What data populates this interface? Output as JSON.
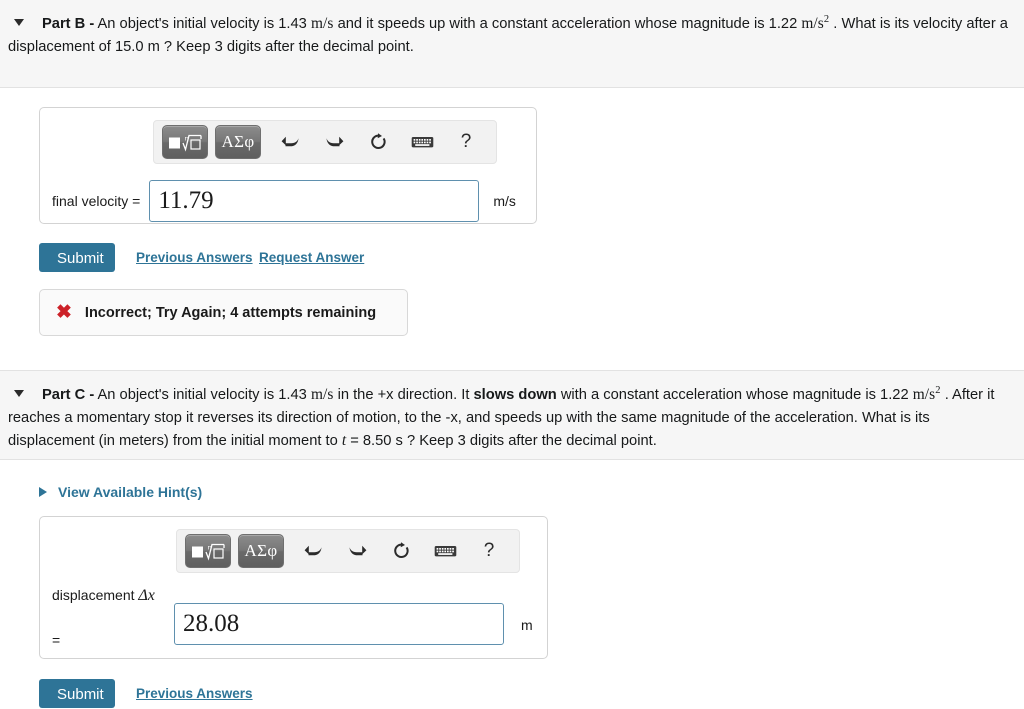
{
  "part_b": {
    "caret_icon": "caret-down-icon",
    "label": "Part B -",
    "text_1": " An object's initial velocity is 1.43 ",
    "math_1": "m/s",
    "text_2": " and it speeds up with a constant acceleration whose magnitude is 1.22 ",
    "math_2": "m/s",
    "math_2_sup": "2",
    "text_3": " . What is its velocity after a displacement of 15.0 m ? Keep 3 digits after the decimal point.",
    "toolbar": {
      "template_button": "template-icon",
      "greek_button": "ΑΣφ",
      "undo_icon": "undo-icon",
      "redo_icon": "redo-icon",
      "reset_icon": "reset-icon",
      "keyboard_icon": "keyboard-icon",
      "help_label": "?"
    },
    "field_label": "final velocity =",
    "field_value": "11.79",
    "field_unit": "m/s",
    "submit_label": "Submit",
    "previous_answers_label": "Previous Answers",
    "request_answer_label": "Request Answer",
    "feedback_icon": "x-mark-icon",
    "feedback_text": "Incorrect; Try Again; 4 attempts remaining"
  },
  "part_c": {
    "caret_icon": "caret-down-icon",
    "label": "Part C -",
    "text_1": " An object's initial velocity is 1.43 ",
    "math_1": "m/s",
    "text_2": " in the +x direction. It ",
    "bold_1": "slows down",
    "text_3": " with a constant acceleration whose magnitude is 1.22 ",
    "math_2": "m/s",
    "math_2_sup": "2",
    "text_4": " . After it reaches a momentary stop it reverses its direction of motion, to the -x, and speeds up with the same magnitude of the acceleration. What is its displacement (in meters) from the initial moment to ",
    "math_t": "t",
    "text_5": " = 8.50 s ? Keep 3 digits after the decimal point.",
    "hints_caret_icon": "caret-right-icon",
    "hints_label": "View Available Hint(s)",
    "toolbar": {
      "template_button": "template-icon",
      "greek_button": "ΑΣφ",
      "undo_icon": "undo-icon",
      "redo_icon": "redo-icon",
      "reset_icon": "reset-icon",
      "keyboard_icon": "keyboard-icon",
      "help_label": "?"
    },
    "field_label_text": "displacement ",
    "field_label_math": "Δx",
    "field_label_equals": "=",
    "field_value": "28.08",
    "field_unit": "m",
    "submit_label": "Submit",
    "previous_answers_label": "Previous Answers"
  },
  "colors": {
    "accent": "#2e7497",
    "error": "#cc2128",
    "band_bg": "#f6f6f6",
    "input_border": "#5f90ae"
  }
}
